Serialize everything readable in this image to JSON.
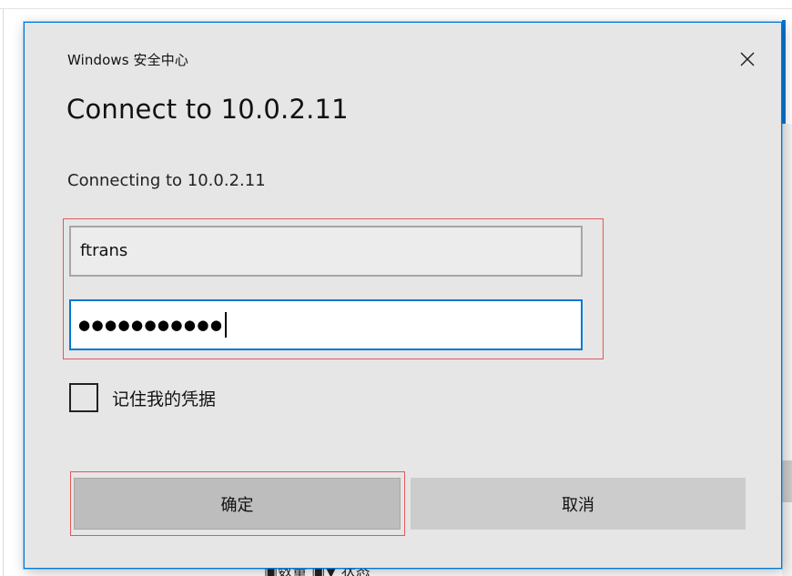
{
  "background": {
    "partial_text": "▣数量 ▣▼ 状态"
  },
  "dialog": {
    "header": "Windows 安全中心",
    "close_symbol": "×",
    "title": "Connect to 10.0.2.11",
    "subtitle": "Connecting to 10.0.2.11",
    "username_value": "ftrans",
    "password_masked": "●●●●●●●●●●●",
    "remember_label": "记住我的凭据",
    "remember_checked": false,
    "ok_label": "确定",
    "cancel_label": "取消"
  },
  "colors": {
    "accent": "#0078d7",
    "dialog_bg": "#e6e6e6",
    "button_bg": "#cccccc",
    "highlight": "#e05a5a"
  }
}
